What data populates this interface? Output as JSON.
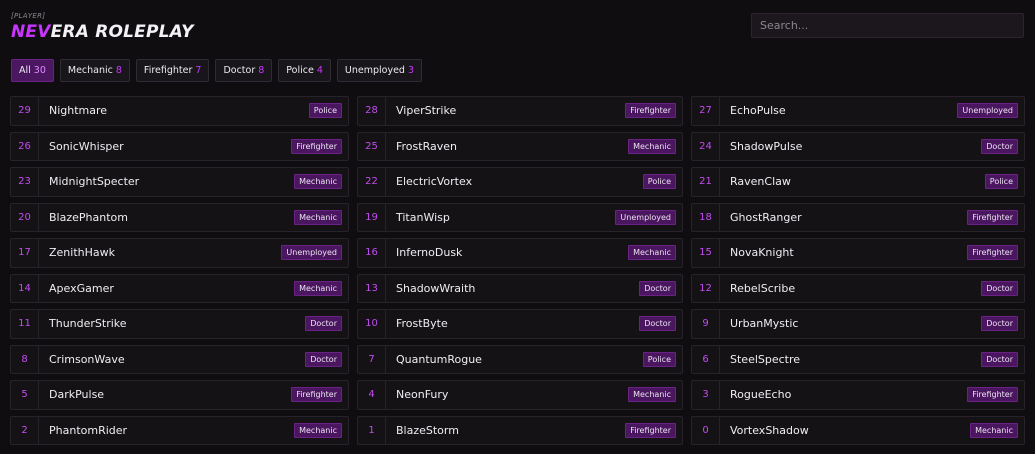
{
  "header": {
    "supertitle": "[PLAYER]",
    "title_accent": "NEV",
    "title_rest": "ERA ROLEPLAY"
  },
  "search": {
    "placeholder": "Search..."
  },
  "colors": {
    "accent": "#c935ff",
    "badge_bg": "#4a1660",
    "background": "#0f0d10"
  },
  "filters": [
    {
      "label": "All",
      "count": "30",
      "active": true
    },
    {
      "label": "Mechanic",
      "count": "8",
      "active": false
    },
    {
      "label": "Firefighter",
      "count": "7",
      "active": false
    },
    {
      "label": "Doctor",
      "count": "8",
      "active": false
    },
    {
      "label": "Police",
      "count": "4",
      "active": false
    },
    {
      "label": "Unemployed",
      "count": "3",
      "active": false
    }
  ],
  "players": [
    {
      "id": "29",
      "name": "Nightmare",
      "job": "Police"
    },
    {
      "id": "28",
      "name": "ViperStrike",
      "job": "Firefighter"
    },
    {
      "id": "27",
      "name": "EchoPulse",
      "job": "Unemployed"
    },
    {
      "id": "26",
      "name": "SonicWhisper",
      "job": "Firefighter"
    },
    {
      "id": "25",
      "name": "FrostRaven",
      "job": "Mechanic"
    },
    {
      "id": "24",
      "name": "ShadowPulse",
      "job": "Doctor"
    },
    {
      "id": "23",
      "name": "MidnightSpecter",
      "job": "Mechanic"
    },
    {
      "id": "22",
      "name": "ElectricVortex",
      "job": "Police"
    },
    {
      "id": "21",
      "name": "RavenClaw",
      "job": "Police"
    },
    {
      "id": "20",
      "name": "BlazePhantom",
      "job": "Mechanic"
    },
    {
      "id": "19",
      "name": "TitanWisp",
      "job": "Unemployed"
    },
    {
      "id": "18",
      "name": "GhostRanger",
      "job": "Firefighter"
    },
    {
      "id": "17",
      "name": "ZenithHawk",
      "job": "Unemployed"
    },
    {
      "id": "16",
      "name": "InfernoDusk",
      "job": "Mechanic"
    },
    {
      "id": "15",
      "name": "NovaKnight",
      "job": "Firefighter"
    },
    {
      "id": "14",
      "name": "ApexGamer",
      "job": "Mechanic"
    },
    {
      "id": "13",
      "name": "ShadowWraith",
      "job": "Doctor"
    },
    {
      "id": "12",
      "name": "RebelScribe",
      "job": "Doctor"
    },
    {
      "id": "11",
      "name": "ThunderStrike",
      "job": "Doctor"
    },
    {
      "id": "10",
      "name": "FrostByte",
      "job": "Doctor"
    },
    {
      "id": "9",
      "name": "UrbanMystic",
      "job": "Doctor"
    },
    {
      "id": "8",
      "name": "CrimsonWave",
      "job": "Doctor"
    },
    {
      "id": "7",
      "name": "QuantumRogue",
      "job": "Police"
    },
    {
      "id": "6",
      "name": "SteelSpectre",
      "job": "Doctor"
    },
    {
      "id": "5",
      "name": "DarkPulse",
      "job": "Firefighter"
    },
    {
      "id": "4",
      "name": "NeonFury",
      "job": "Mechanic"
    },
    {
      "id": "3",
      "name": "RogueEcho",
      "job": "Firefighter"
    },
    {
      "id": "2",
      "name": "PhantomRider",
      "job": "Mechanic"
    },
    {
      "id": "1",
      "name": "BlazeStorm",
      "job": "Firefighter"
    },
    {
      "id": "0",
      "name": "VortexShadow",
      "job": "Mechanic"
    }
  ]
}
